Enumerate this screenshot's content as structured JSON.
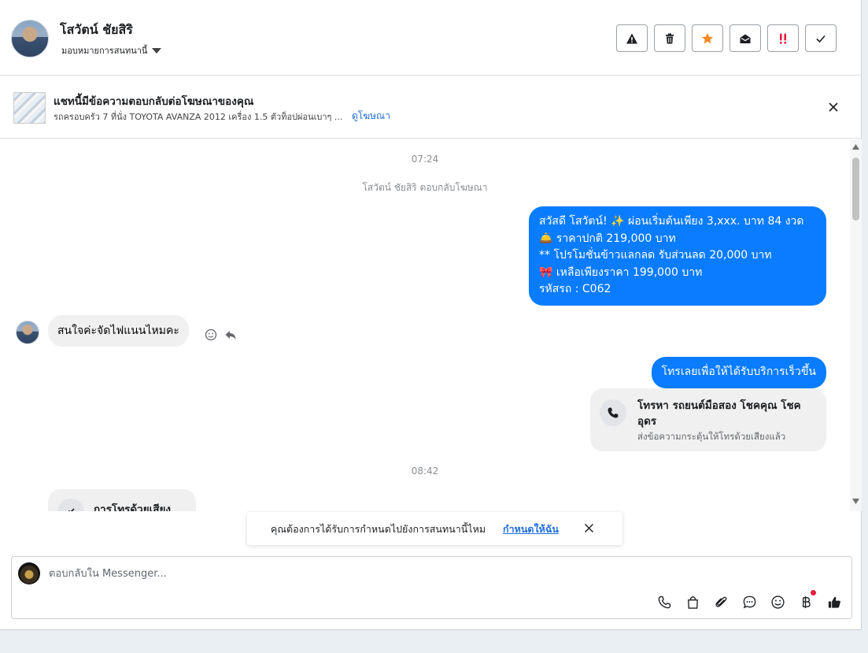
{
  "header": {
    "contact_name": "โสวัตน์ ชัยสิริ",
    "assign_label": "มอบหมายการสนทนานี้",
    "actions": [
      {
        "name": "warning-icon",
        "color": "#1c1e21"
      },
      {
        "name": "trash-icon",
        "color": "#1c1e21"
      },
      {
        "name": "star-icon",
        "color": "#f08a24"
      },
      {
        "name": "envelope-open-icon",
        "color": "#1c1e21"
      },
      {
        "name": "double-exclamation-icon",
        "color": "#e41e3f"
      },
      {
        "name": "check-icon",
        "color": "#1c1e21"
      }
    ]
  },
  "banner": {
    "title": "แชทนี้มีข้อความตอบกลับต่อโฆษณาของคุณ",
    "subtitle": "รถครอบครัว 7 ที่นั่ง TOYOTA AVANZA 2012 เครื่อง 1.5 ตัวท็อปผ่อนเบาๆ ...",
    "link": "ดูโฆษณา"
  },
  "thread": {
    "time1": "07:24",
    "system_msg": "โสวัตน์ ชัยสิริ ตอบกลับโฆษณา",
    "outgoing1": [
      "สวัสดี โสวัตน์! ✨  ผ่อนเริ่มต้นเพียง 3,xxx. บาท 84 งวด",
      "🛎️ ราคาปกติ 219,000 บาท",
      "** โปรโมชั่นข้าวแลกลด รับส่วนลด 20,000 บาท",
      "🎀  เหลือเพียงราคา 199,000 บาท",
      " รหัสรถ : C062"
    ],
    "incoming1": "สนใจค่ะจัดไฟแนนไหมคะ",
    "outgoing2": "โทรเลยเพื่อให้ได้รับบริการเร็วขึ้น",
    "call_card": {
      "title": "โทรหา รถยนต์มือสอง โชคคุณ โชค อุดร",
      "subtitle": "ส่งข้อความกระตุ้นให้โทรด้วยเสียงแล้ว"
    },
    "time2": "08:42",
    "incoming2": "การโทรด้วยเสียง"
  },
  "toast": {
    "text": "คุณต้องการได้รับการกำหนดไปยังการสนทนานี้ไหม",
    "link": "กำหนดให้ฉัน"
  },
  "composer": {
    "placeholder": "ตอบกลับใน Messenger...",
    "tools": [
      "phone-icon",
      "shopping-bag-icon",
      "paperclip-icon",
      "chat-bubble-icon",
      "smiley-icon",
      "baht-icon",
      "thumbs-up-icon"
    ],
    "accent": "#0a7cff"
  }
}
